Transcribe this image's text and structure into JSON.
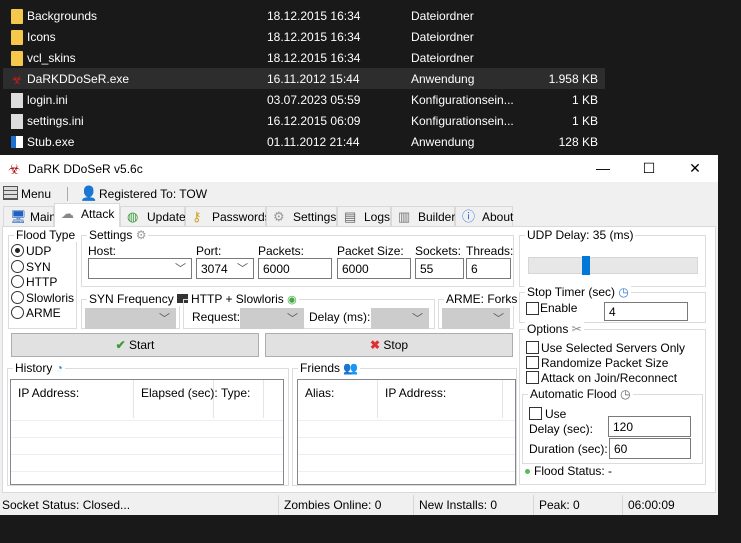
{
  "files": [
    {
      "name": "Backgrounds",
      "date": "18.12.2015 16:34",
      "type": "Dateiordner",
      "size": "",
      "icon": "folder-icon"
    },
    {
      "name": "Icons",
      "date": "18.12.2015 16:34",
      "type": "Dateiordner",
      "size": "",
      "icon": "folder-icon"
    },
    {
      "name": "vcl_skins",
      "date": "18.12.2015 16:34",
      "type": "Dateiordner",
      "size": "",
      "icon": "folder-icon"
    },
    {
      "name": "DaRKDDoSeR.exe",
      "date": "16.11.2012 15:44",
      "type": "Anwendung",
      "size": "1.958 KB",
      "icon": "app-icon"
    },
    {
      "name": "login.ini",
      "date": "03.07.2023 05:59",
      "type": "Konfigurationsein...",
      "size": "1 KB",
      "icon": "ini-icon"
    },
    {
      "name": "settings.ini",
      "date": "16.12.2015 06:09",
      "type": "Konfigurationsein...",
      "size": "1 KB",
      "icon": "ini-icon"
    },
    {
      "name": "Stub.exe",
      "date": "01.11.2012 21:44",
      "type": "Anwendung",
      "size": "128 KB",
      "icon": "exe-icon"
    }
  ],
  "window": {
    "title": "DaRK DDoSeR v5.6c",
    "minimize": "—",
    "maximize": "☐",
    "close": "✕"
  },
  "menubar": {
    "menu": "Menu",
    "registered": "Registered To: TOW"
  },
  "tabs": [
    "Main",
    "Attack",
    "Update",
    "Passwords",
    "Settings",
    "Logs",
    "Builder",
    "About"
  ],
  "flood_type": {
    "label": "Flood Type",
    "options": [
      "UDP",
      "SYN",
      "HTTP",
      "Slowloris",
      "ARME"
    ],
    "selected": "UDP"
  },
  "settings": {
    "label": "Settings",
    "host_label": "Host:",
    "host": "",
    "port_label": "Port:",
    "port": "3074",
    "packets_label": "Packets:",
    "packets": "6000",
    "packet_size_label": "Packet Size:",
    "packet_size": "6000",
    "sockets_label": "Sockets:",
    "sockets": "55",
    "threads_label": "Threads:",
    "threads": "6"
  },
  "syn": {
    "label": "SYN Frequency"
  },
  "http": {
    "label": "HTTP + Slowloris",
    "request_label": "Request:",
    "delay_label": "Delay (ms):"
  },
  "arme": {
    "label": "ARME: Forks"
  },
  "buttons": {
    "start": "Start",
    "stop": "Stop"
  },
  "history": {
    "label": "History",
    "columns": [
      "IP Address:",
      "Elapsed (sec):",
      "Type:"
    ]
  },
  "friends": {
    "label": "Friends",
    "columns": [
      "Alias:",
      "IP Address:"
    ]
  },
  "udp_delay": {
    "label": "UDP Delay: 35 (ms)",
    "value": 35,
    "fraction": 0.33
  },
  "stop_timer": {
    "label": "Stop Timer (sec)",
    "enable": "Enable",
    "value": "4"
  },
  "options": {
    "label": "Options",
    "items": [
      "Use Selected Servers Only",
      "Randomize Packet Size",
      "Attack on Join/Reconnect"
    ]
  },
  "auto_flood": {
    "label": "Automatic Flood",
    "use": "Use",
    "delay_label": "Delay (sec):",
    "delay": "120",
    "duration_label": "Duration (sec):",
    "duration": "60"
  },
  "flood_status": "Flood Status: -",
  "status": {
    "socket": "Socket Status: Closed...",
    "zombies": "Zombies Online: 0",
    "installs": "New Installs: 0",
    "peak": "Peak: 0",
    "time": "06:00:09"
  },
  "colors": {
    "accent": "#0078d7",
    "status_dot": "#5cb85c"
  }
}
